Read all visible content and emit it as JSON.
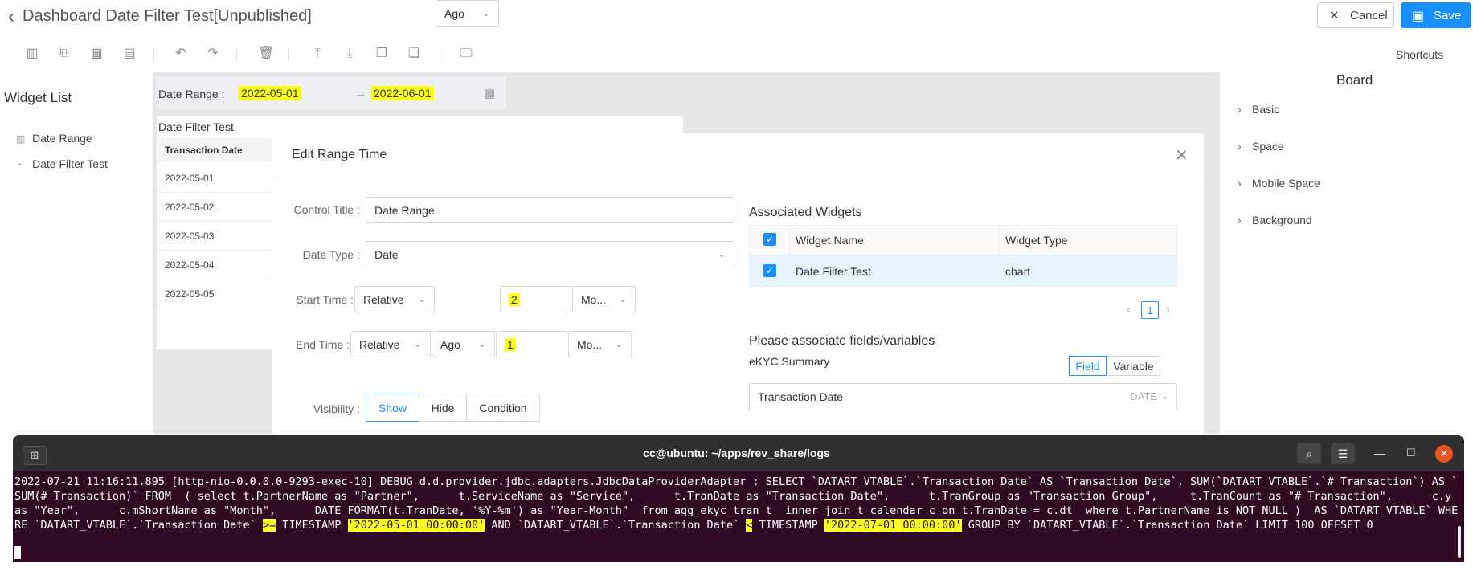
{
  "header": {
    "title": "Dashboard Date Filter Test[Unpublished]",
    "cancel_label": "Cancel",
    "save_label": "Save",
    "shortcuts_label": "Shortcuts"
  },
  "widget_list": {
    "title": "Widget List",
    "items": [
      {
        "label": "Date Range",
        "icon": "date-range-icon"
      },
      {
        "label": "Date Filter Test",
        "icon": "chart-icon"
      }
    ]
  },
  "canvas": {
    "date_range_label": "Date Range",
    "start": "2022-05-01",
    "end": "2022-06-01",
    "chart_title": "Date Filter Test",
    "column_header": "Transaction Date",
    "rows": [
      "2022-05-01",
      "2022-05-02",
      "2022-05-03",
      "2022-05-04",
      "2022-05-05"
    ]
  },
  "board": {
    "title": "Board",
    "items": [
      "Basic",
      "Space",
      "Mobile Space",
      "Background"
    ]
  },
  "modal": {
    "title": "Edit Range Time",
    "control_title_label": "Control Title",
    "control_title_value": "Date Range",
    "date_type_label": "Date Type",
    "date_type_value": "Date",
    "start_time_label": "Start Time",
    "start_mode": "Relative",
    "start_direction": "Ago",
    "start_amount": "2",
    "start_unit": "Mo...",
    "end_time_label": "End Time",
    "end_mode": "Relative",
    "end_direction": "Ago",
    "end_amount": "1",
    "end_unit": "Mo...",
    "visibility_label": "Visibility",
    "visibility_options": [
      "Show",
      "Hide",
      "Condition"
    ],
    "associated_widgets_title": "Associated Widgets",
    "col_widget_name": "Widget Name",
    "col_widget_type": "Widget Type",
    "widget_row": {
      "name": "Date Filter Test",
      "type": "chart"
    },
    "page": "1",
    "associate_fields_title": "Please associate fields/variables",
    "source_name": "eKYC Summary",
    "field_tab": "Field",
    "variable_tab": "Variable",
    "selected_field": "Transaction Date",
    "selected_field_type": "DATE"
  },
  "terminal": {
    "title": "cc@ubuntu: ~/apps/rev_share/logs",
    "log_part1": "2022-07-21 11:16:11.895 [http-nio-0.0.0.0-9293-exec-10] DEBUG d.d.provider.jdbc.adapters.JdbcDataProviderAdapter : SELECT `DATART_VTABLE`.`Transaction Date` AS `Transaction Date`, SUM(`DATART_VTABLE`.`# Transaction`) AS `SUM(# Transaction)` FROM  ( select t.PartnerName as \"Partner\",      t.ServiceName as \"Service\",      t.TranDate as \"Transaction Date\",      t.TranGroup as \"Transaction Group\",     t.TranCount as \"# Transaction\",      c.y as \"Year\",      c.mShortName as \"Month\",      DATE_FORMAT(t.TranDate, '%Y-%m') as \"Year-Month\"  from agg_ekyc_tran t  inner join t_calendar c on t.TranDate = c.dt  where t.PartnerName is NOT NULL )  AS `DATART_VTABLE` WHERE `DATART_VTABLE`.`Transaction Date` ",
    "hl_ge": ">=",
    "log_part2": " TIMESTAMP ",
    "hl_start": "'2022-05-01 00:00:00'",
    "log_part3": " AND `DATART_VTABLE`.`Transaction Date` ",
    "hl_lt": "<",
    "log_part4": " TIMESTAMP ",
    "hl_end": "'2022-07-01 00:00:00'",
    "log_part5": " GROUP BY `DATART_VTABLE`.`Transaction Date` LIMIT 100 OFFSET 0"
  }
}
